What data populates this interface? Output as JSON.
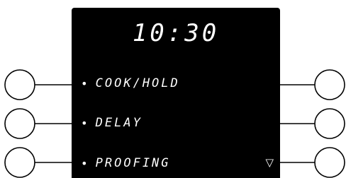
{
  "display": {
    "clock": "10:30",
    "menu_items": [
      {
        "bullet": "•",
        "label": "COOK/HOLD"
      },
      {
        "bullet": "•",
        "label": "DELAY"
      },
      {
        "bullet": "•",
        "label": "PROOFING"
      }
    ],
    "scroll_arrow": "▽"
  },
  "colors": {
    "screen": "#000000",
    "text": "#ffffff",
    "callout": "#000000"
  }
}
